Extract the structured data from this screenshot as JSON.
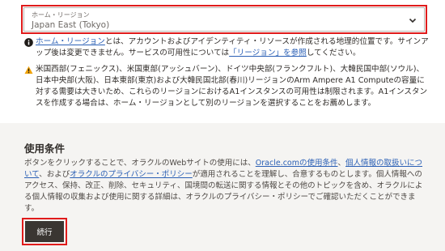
{
  "region_select": {
    "label": "ホーム・リージョン",
    "value": "Japan East (Tokyo)"
  },
  "info_note": {
    "link_text": "ホーム・リージョン",
    "text_a": "とは、アカウントおよびアイデンティティ・リソースが作成される地理的位置です。サインアップ後は変更できません。サービスの可用性については",
    "link2_text": "「リージョン」を参照",
    "text_b": "してください。"
  },
  "warning_note": {
    "text": "米国西部(フェニックス)、米国東部(アッシュバーン)、ドイツ中央部(フランクフルト)、大韓民国中部(ソウル)、日本中央部(大阪)、日本東部(東京)および大韓民国北部(春川)リージョンのArm Ampere A1 Computeの容量に対する需要は大きいため、これらのリージョンにおけるA1インスタンスの可用性は制限されます。A1インスタンスを作成する場合は、ホーム・リージョンとして別のリージョンを選択することをお薦めします。"
  },
  "terms": {
    "title": "使用条件",
    "text_a": "ボタンをクリックすることで、オラクルのWebサイトの使用には、",
    "link_a": "Oracle.comの使用条件",
    "text_b": "、",
    "link_b": "個人情報の取扱いについて",
    "text_c": "、および",
    "link_c": "オラクルのプライバシー・ポリシー",
    "text_d": "が適用されることを理解し、合意するものとします。個人情報へのアクセス、保持、改正、削除、セキュリティ、国境間の転送に関する情報とその他のトピックを含め、オラクルによる個人情報の収集および使用に関する詳細は、オラクルのプライバシー・ポリシーでご確認いただくことができます。"
  },
  "continue_button": {
    "label": "続行"
  },
  "colors": {
    "highlight": "#e01b1b",
    "link": "#2a5fb5",
    "button": "#3a3632"
  },
  "icons": {
    "select": "chevron-down-icon",
    "info": "info-icon",
    "warning": "warning-icon"
  }
}
